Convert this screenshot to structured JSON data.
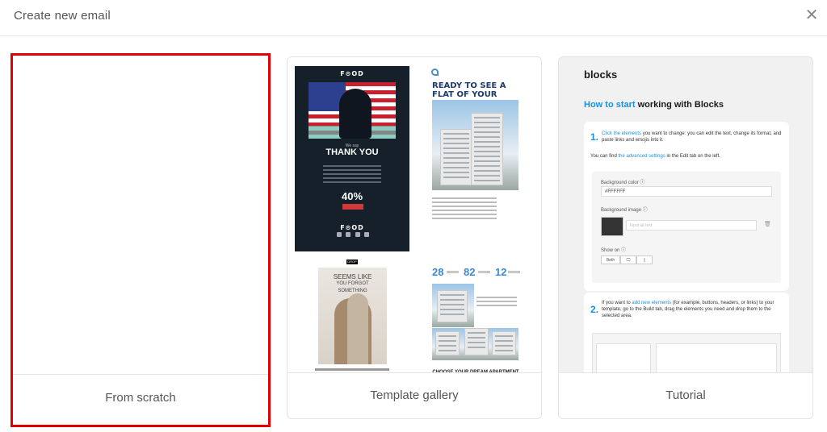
{
  "dialog": {
    "title": "Create new email",
    "close_glyph": "✕"
  },
  "cards": {
    "scratch": {
      "label": "From scratch"
    },
    "gallery": {
      "label": "Template gallery"
    },
    "tutorial": {
      "label": "Tutorial"
    }
  },
  "gallery_preview": {
    "food_logo": "F⊙OD",
    "we_say": "We say",
    "thank_you": "THANK YOU",
    "discount": "40%",
    "drop_badge": "DROP",
    "couple_heading": "SEEMS LIKE",
    "couple_sub": "YOU FORGOT SOMETHING",
    "flat_title": "READY TO SEE A FLAT OF YOUR DREAMS?",
    "stats": [
      "28",
      "82",
      "12"
    ],
    "choose": "CHOOSE YOUR DREAM APARTMENT"
  },
  "tutorial_preview": {
    "logo": "blocks",
    "heading_link": "How to start",
    "heading_rest": " working with Blocks",
    "step1_num": "1.",
    "step1_link": "Click the elements",
    "step1_text": " you want to change: you can edit the text, change its format, and paste links and emojis into it.",
    "adv_pre": "You can find ",
    "adv_link": "the advanced settings",
    "adv_post": " in the Edit tab on the left.",
    "bg_color_label": "Background color ⓘ",
    "bg_color_value": "#FFFFFF",
    "bg_image_label": "Background image ⓘ",
    "alt_placeholder": "Input alt text",
    "show_on_label": "Show on ⓘ",
    "show_on_options": [
      "Both",
      "🖵",
      "▯"
    ],
    "step2_num": "2.",
    "step2_pre": "If you want to ",
    "step2_link": "add new elements",
    "step2_text": " (for example, buttons, headers, or links) to your template, go to the Build tab, drag the elements you need and drop them to the selected area."
  },
  "colors": {
    "selection_border": "#e30000",
    "link_blue": "#1b8fe0"
  }
}
